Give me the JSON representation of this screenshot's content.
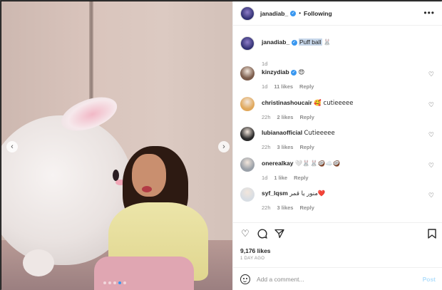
{
  "post": {
    "username": "janadiab_",
    "follow_status": "Following",
    "separator": "•",
    "more_icon": "more-icon"
  },
  "caption": {
    "username": "janadiab_",
    "text": "Puff ball",
    "emoji": "🐰",
    "time": "1d"
  },
  "comments": [
    {
      "username": "kinzydiab",
      "verified": true,
      "text": "😍",
      "time": "1d",
      "likes": "11 likes",
      "reply": "Reply"
    },
    {
      "username": "christinashoucair",
      "verified": false,
      "text": "🥰 cutieeeee",
      "time": "22h",
      "likes": "2 likes",
      "reply": "Reply"
    },
    {
      "username": "lubianaofficial",
      "verified": false,
      "text": "Cutieeeee",
      "time": "22h",
      "likes": "3 likes",
      "reply": "Reply"
    },
    {
      "username": "onerealkay",
      "verified": false,
      "text": "🤍🐰🐰🥥☁️🥥",
      "time": "1d",
      "likes": "1 like",
      "reply": "Reply"
    },
    {
      "username": "syf_lqsm",
      "verified": false,
      "text": "منور يا قمر❤️",
      "time": "22h",
      "likes": "3 likes",
      "reply": "Reply"
    }
  ],
  "likes_text": "9,176 likes",
  "time_ago": "1 DAY AGO",
  "add_comment": {
    "placeholder": "Add a comment...",
    "post_label": "Post"
  },
  "carousel": {
    "prev": "‹",
    "next": "›",
    "count": 5,
    "active_index": 3
  },
  "colors": {
    "link_blue": "#3897f0",
    "post_disabled": "#b2dffc",
    "secondary_text": "#8e8e8e"
  }
}
